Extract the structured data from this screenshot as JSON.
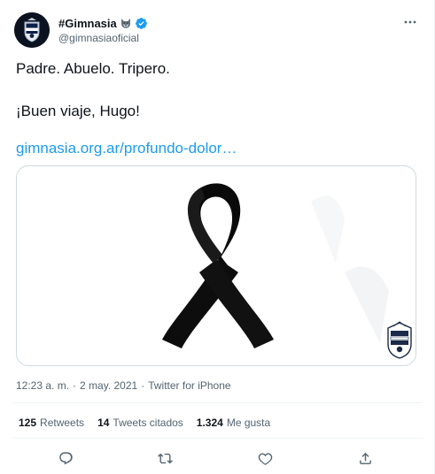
{
  "author": {
    "display_name": "#Gimnasia",
    "handle": "@gimnasiaoficial",
    "badge_icons": [
      "wolf-emoji-icon",
      "verified-badge-icon"
    ],
    "verified_color": "#1d9bf0"
  },
  "tweet": {
    "line1": "Padre. Abuelo. Tripero.",
    "line2": "¡Buen viaje, Hugo!",
    "link_text": "gimnasia.org.ar/profundo-dolor…"
  },
  "media": {
    "icons": [
      "black-mourning-ribbon",
      "gimnasia-crest-icon"
    ]
  },
  "meta": {
    "time": "12:23 a. m.",
    "separator": "·",
    "date": "2 may. 2021",
    "source": "Twitter for iPhone"
  },
  "stats": {
    "retweets_count": "125",
    "retweets_label": "Retweets",
    "quotes_count": "14",
    "quotes_label": "Tweets citados",
    "likes_count": "1.324",
    "likes_label": "Me gusta"
  },
  "actions": [
    "reply-icon",
    "retweet-icon",
    "like-icon",
    "share-icon"
  ],
  "colors": {
    "text": "#0f1419",
    "secondary": "#536471",
    "link": "#1d9bf0",
    "border": "#cfd9de"
  }
}
